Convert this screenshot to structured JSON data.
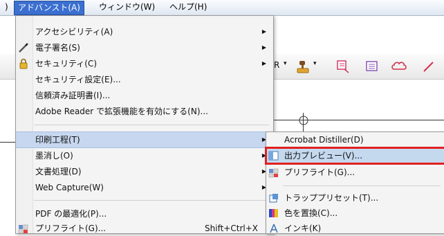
{
  "menubar": {
    "items": [
      {
        "label": ")"
      },
      {
        "label": "アドバンスト(A)"
      },
      {
        "label": "ウィンドウ(W)"
      },
      {
        "label": "ヘルプ(H)"
      }
    ]
  },
  "toolbar": {
    "r_label": "R"
  },
  "menu": {
    "items": [
      {
        "label": "アクセシビリティ(A)"
      },
      {
        "label": "電子署名(S)"
      },
      {
        "label": "セキュリティ(C)"
      },
      {
        "label": "セキュリティ設定(E)..."
      },
      {
        "label": "信頼済み証明書(I)..."
      },
      {
        "label": "Adobe Reader で拡張機能を有効にする(N)..."
      },
      {
        "label": "印刷工程(T)"
      },
      {
        "label": "墨消し(O)"
      },
      {
        "label": "文書処理(D)"
      },
      {
        "label": "Web Capture(W)"
      },
      {
        "label": "PDF の最適化(P)..."
      },
      {
        "label": "プリフライト(G)...",
        "shortcut": "Shift+Ctrl+X"
      }
    ]
  },
  "submenu": {
    "items": [
      {
        "label": "Acrobat Distiller(D)"
      },
      {
        "label": "出力プレビュー(V)..."
      },
      {
        "label": "プリフライト(G)..."
      },
      {
        "label": "トラッププリセット(T)..."
      },
      {
        "label": "色を置換(C)..."
      },
      {
        "label": "インキ(K)"
      }
    ]
  },
  "colors": {
    "menubar_active": "#3b6fd0",
    "highlight": "#c6d7ef",
    "callout_border": "#e12020"
  }
}
